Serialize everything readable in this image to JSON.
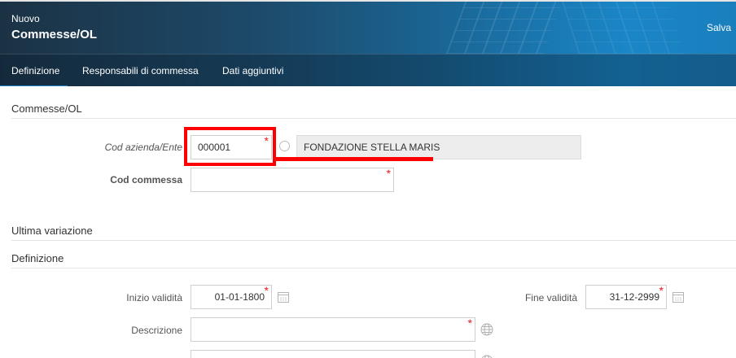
{
  "header": {
    "subtitle": "Nuovo",
    "title": "Commesse/OL",
    "save_label": "Salva"
  },
  "tabs": [
    {
      "label": "Definizione",
      "active": true
    },
    {
      "label": "Responsabili di commessa",
      "active": false
    },
    {
      "label": "Dati aggiuntivi",
      "active": false
    }
  ],
  "section_main": {
    "title": "Commesse/OL",
    "cod_azienda_label": "Cod azienda/Ente",
    "cod_azienda_value": "000001",
    "azienda_name": "FONDAZIONE STELLA MARIS",
    "cod_commessa_label": "Cod commessa",
    "cod_commessa_value": ""
  },
  "section_ultima": {
    "title": "Ultima variazione"
  },
  "section_def": {
    "title": "Definizione",
    "inizio_label": "Inizio validità",
    "inizio_value": "01-01-1800",
    "fine_label": "Fine validità",
    "fine_value": "31-12-2999",
    "descrizione_label": "Descrizione",
    "descrizione_value": ""
  },
  "colors": {
    "required": "#e31b1b",
    "highlight": "#ff0000",
    "accent": "#1a86c7"
  }
}
